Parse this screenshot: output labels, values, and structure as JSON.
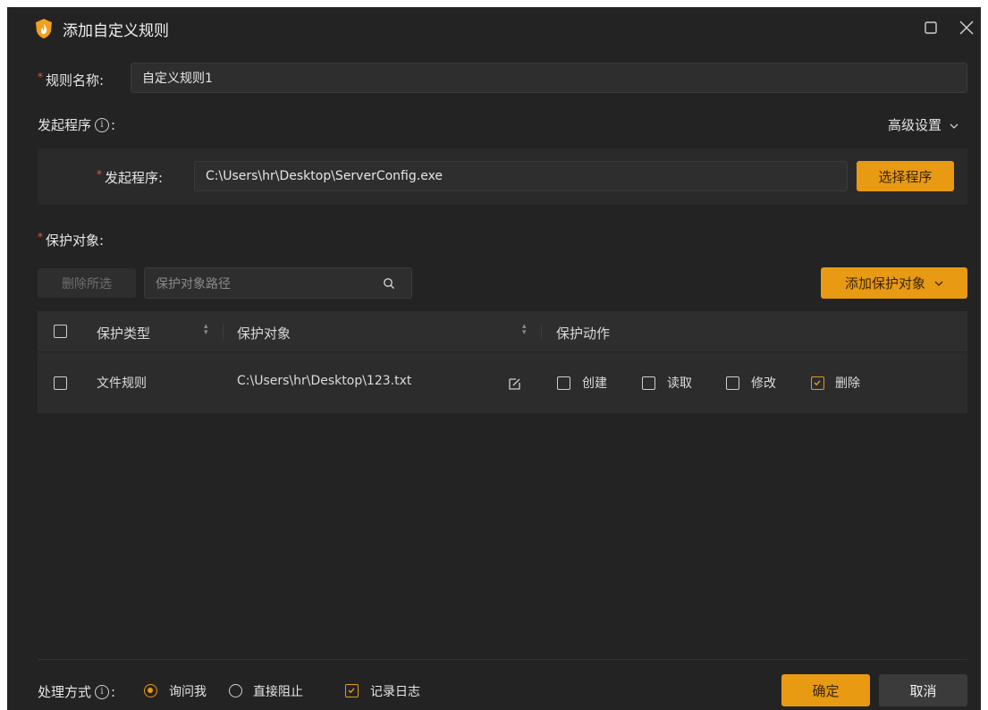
{
  "window": {
    "title": "添加自定义规则"
  },
  "rule_name": {
    "label": "规则名称:",
    "value": "自定义规则1"
  },
  "initiator_section": {
    "label": "发起程序",
    "colon": ":",
    "advanced": "高级设置"
  },
  "initiator": {
    "label": "发起程序:",
    "value": "C:\\Users\\hr\\Desktop\\ServerConfig.exe",
    "select_button": "选择程序"
  },
  "protect_section": {
    "label": "保护对象:"
  },
  "toolbar": {
    "delete_selected": "删除所选",
    "search_placeholder": "保护对象路径",
    "add_button": "添加保护对象"
  },
  "table": {
    "headers": [
      "保护类型",
      "保护对象",
      "保护动作"
    ],
    "rows": [
      {
        "type": "文件规则",
        "object": "C:\\Users\\hr\\Desktop\\123.txt",
        "actions": [
          {
            "label": "创建",
            "checked": false
          },
          {
            "label": "读取",
            "checked": false
          },
          {
            "label": "修改",
            "checked": false
          },
          {
            "label": "删除",
            "checked": true
          }
        ]
      }
    ]
  },
  "footer": {
    "handling_label": "处理方式",
    "colon": ":",
    "options": [
      {
        "label": "询问我",
        "selected": true
      },
      {
        "label": "直接阻止",
        "selected": false
      }
    ],
    "log": {
      "label": "记录日志",
      "checked": true
    },
    "ok": "确定",
    "cancel": "取消"
  },
  "colors": {
    "accent": "#e89a13",
    "background": "#232323",
    "required": "#e0612d"
  }
}
